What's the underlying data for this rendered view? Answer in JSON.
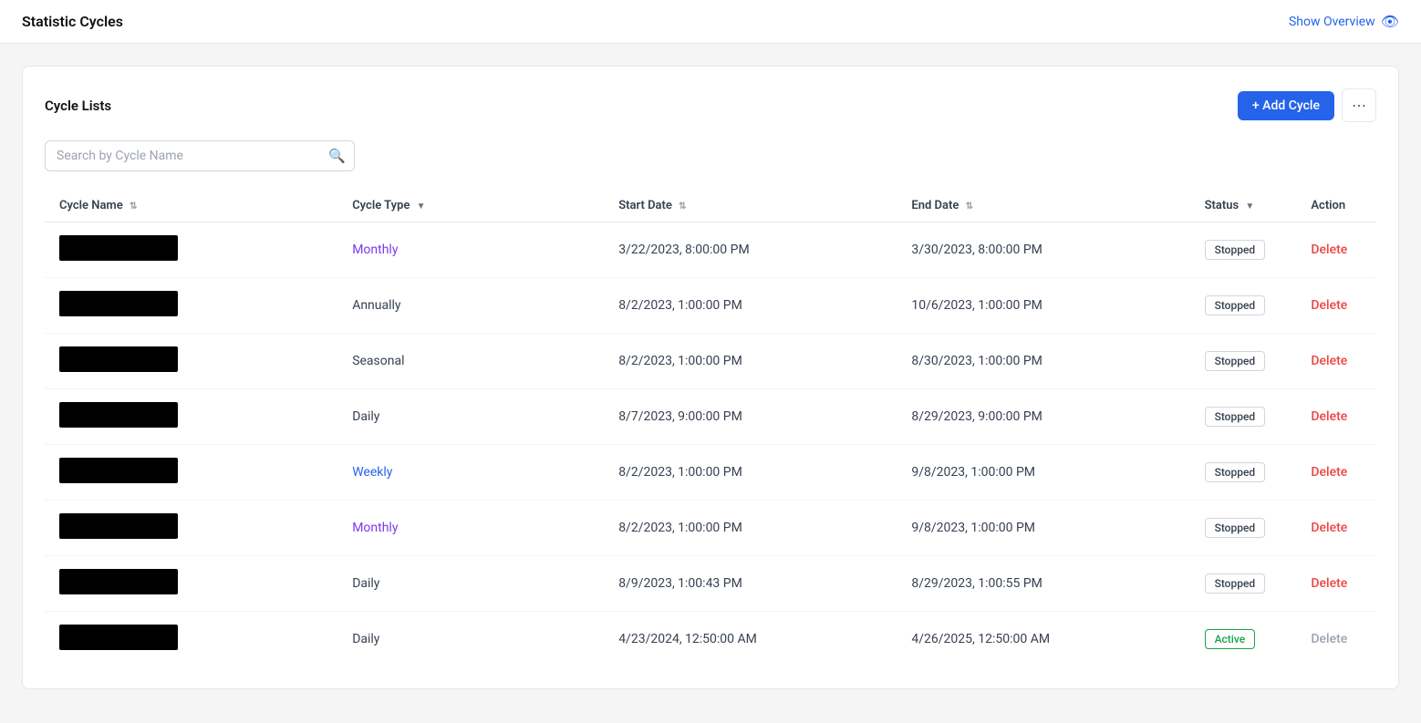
{
  "header": {
    "title": "Statistic Cycles",
    "show_overview_label": "Show Overview"
  },
  "card": {
    "title": "Cycle Lists",
    "add_cycle_label": "+ Add Cycle",
    "more_icon": "⋯"
  },
  "search": {
    "placeholder": "Search by Cycle Name"
  },
  "table": {
    "columns": [
      {
        "key": "cycle_name",
        "label": "Cycle Name",
        "sort": "updown"
      },
      {
        "key": "cycle_type",
        "label": "Cycle Type",
        "sort": "filter"
      },
      {
        "key": "start_date",
        "label": "Start Date",
        "sort": "updown"
      },
      {
        "key": "end_date",
        "label": "End Date",
        "sort": "updown"
      },
      {
        "key": "status",
        "label": "Status",
        "sort": "filter"
      },
      {
        "key": "action",
        "label": "Action",
        "sort": "none"
      }
    ],
    "rows": [
      {
        "cycle_name": "",
        "blocked": true,
        "cycle_type": "Monthly",
        "type_class": "monthly",
        "start_date": "3/22/2023, 8:00:00 PM",
        "end_date": "3/30/2023, 8:00:00 PM",
        "status": "Stopped",
        "status_class": "stopped",
        "action": "Delete",
        "action_disabled": false
      },
      {
        "cycle_name": "",
        "blocked": true,
        "cycle_type": "Annually",
        "type_class": "annually",
        "start_date": "8/2/2023, 1:00:00 PM",
        "end_date": "10/6/2023, 1:00:00 PM",
        "status": "Stopped",
        "status_class": "stopped",
        "action": "Delete",
        "action_disabled": false
      },
      {
        "cycle_name": "",
        "blocked": true,
        "cycle_type": "Seasonal",
        "type_class": "seasonal",
        "start_date": "8/2/2023, 1:00:00 PM",
        "end_date": "8/30/2023, 1:00:00 PM",
        "status": "Stopped",
        "status_class": "stopped",
        "action": "Delete",
        "action_disabled": false
      },
      {
        "cycle_name": "",
        "blocked": true,
        "cycle_type": "Daily",
        "type_class": "daily",
        "start_date": "8/7/2023, 9:00:00 PM",
        "end_date": "8/29/2023, 9:00:00 PM",
        "status": "Stopped",
        "status_class": "stopped",
        "action": "Delete",
        "action_disabled": false
      },
      {
        "cycle_name": "",
        "blocked": true,
        "cycle_type": "Weekly",
        "type_class": "weekly",
        "start_date": "8/2/2023, 1:00:00 PM",
        "end_date": "9/8/2023, 1:00:00 PM",
        "status": "Stopped",
        "status_class": "stopped",
        "action": "Delete",
        "action_disabled": false
      },
      {
        "cycle_name": "",
        "blocked": true,
        "cycle_type": "Monthly",
        "type_class": "monthly",
        "start_date": "8/2/2023, 1:00:00 PM",
        "end_date": "9/8/2023, 1:00:00 PM",
        "status": "Stopped",
        "status_class": "stopped",
        "action": "Delete",
        "action_disabled": false
      },
      {
        "cycle_name": "",
        "blocked": true,
        "cycle_type": "Daily",
        "type_class": "daily",
        "start_date": "8/9/2023, 1:00:43 PM",
        "end_date": "8/29/2023, 1:00:55 PM",
        "status": "Stopped",
        "status_class": "stopped",
        "action": "Delete",
        "action_disabled": false
      },
      {
        "cycle_name": "",
        "blocked": true,
        "cycle_type": "Daily",
        "type_class": "daily",
        "start_date": "4/23/2024, 12:50:00 AM",
        "end_date": "4/26/2025, 12:50:00 AM",
        "status": "Active",
        "status_class": "active",
        "action": "Delete",
        "action_disabled": true
      }
    ]
  }
}
